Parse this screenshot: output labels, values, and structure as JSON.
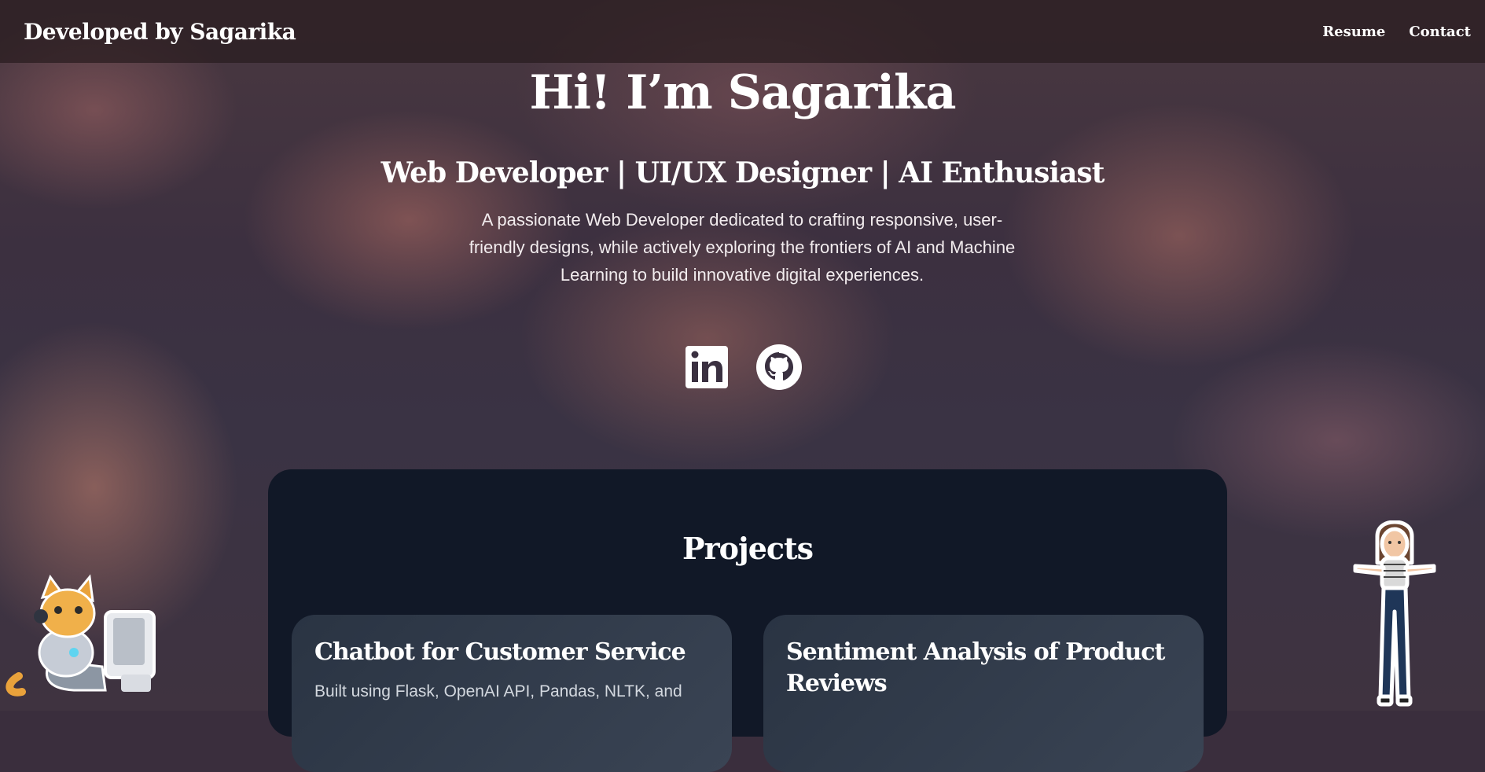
{
  "navbar": {
    "brand": "Developed by Sagarika",
    "links": [
      {
        "label": "Resume"
      },
      {
        "label": "Contact"
      }
    ]
  },
  "hero": {
    "title": "Hi! I’m Sagarika",
    "subtitle": "Web Developer | UI/UX Designer | AI Enthusiast",
    "description": "A passionate Web Developer dedicated to crafting responsive, user-friendly designs, while actively exploring the frontiers of AI and Machine Learning to build innovative digital experiences."
  },
  "social": {
    "icons": [
      "linkedin-icon",
      "github-icon"
    ]
  },
  "projects": {
    "heading": "Projects",
    "cards": [
      {
        "title": "Chatbot for Customer Service",
        "description": "Built using Flask, OpenAI API, Pandas, NLTK, and"
      },
      {
        "title": "Sentiment Analysis of Product Reviews",
        "description": ""
      }
    ]
  },
  "colors": {
    "navbar_bg": "#2a1e20",
    "projects_bg": "#111827",
    "card_bg": "#2f3a4a",
    "text": "#ffffff"
  }
}
